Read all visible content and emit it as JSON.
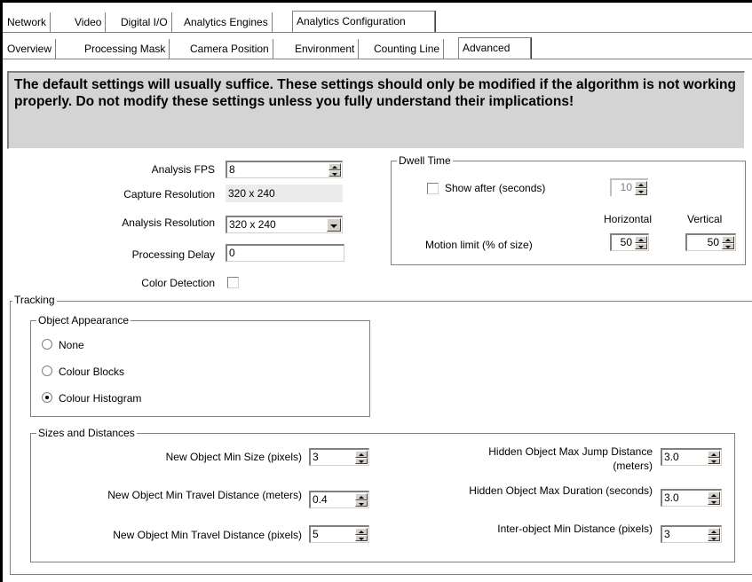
{
  "tabs_top": [
    "Network",
    "Video",
    "Digital I/O",
    "Analytics Engines",
    "Analytics Configuration"
  ],
  "tabs_sub": [
    "Overview",
    "Processing Mask",
    "Camera Position",
    "Environment",
    "Counting Line",
    "Advanced"
  ],
  "warning": "The default settings will usually suffice. These settings should only be modified if the algorithm is not working properly. Do not modify these settings unless you fully understand their implications!",
  "settings": {
    "analysis_fps_label": "Analysis FPS",
    "analysis_fps_value": "8",
    "capture_res_label": "Capture Resolution",
    "capture_res_value": "320 x 240",
    "analysis_res_label": "Analysis Resolution",
    "analysis_res_value": "320 x 240",
    "processing_delay_label": "Processing Delay",
    "processing_delay_value": "0",
    "color_detection_label": "Color Detection"
  },
  "dwell": {
    "title": "Dwell Time",
    "show_after_label": "Show after (seconds)",
    "show_after_value": "10",
    "horizontal_header": "Horizontal",
    "vertical_header": "Vertical",
    "motion_limit_label": "Motion limit (% of size)",
    "horizontal_value": "50",
    "vertical_value": "50"
  },
  "tracking": {
    "title": "Tracking",
    "appearance_title": "Object Appearance",
    "options": [
      "None",
      "Colour Blocks",
      "Colour Histogram"
    ],
    "selected": "Colour Histogram"
  },
  "sizes": {
    "title": "Sizes and Distances",
    "new_min_size_label": "New Object Min Size (pixels)",
    "new_min_size_value": "3",
    "new_min_travel_m_label": "New Object Min Travel Distance (meters)",
    "new_min_travel_m_value": "0.4",
    "new_min_travel_px_label": "New Object Min Travel Distance (pixels)",
    "new_min_travel_px_value": "5",
    "hidden_jump_label_1": "Hidden Object Max Jump Distance",
    "hidden_jump_label_2": "(meters)",
    "hidden_jump_value": "3.0",
    "hidden_duration_label": "Hidden Object Max Duration (seconds)",
    "hidden_duration_value": "3.0",
    "inter_min_label": "Inter-object Min Distance (pixels)",
    "inter_min_value": "3"
  }
}
